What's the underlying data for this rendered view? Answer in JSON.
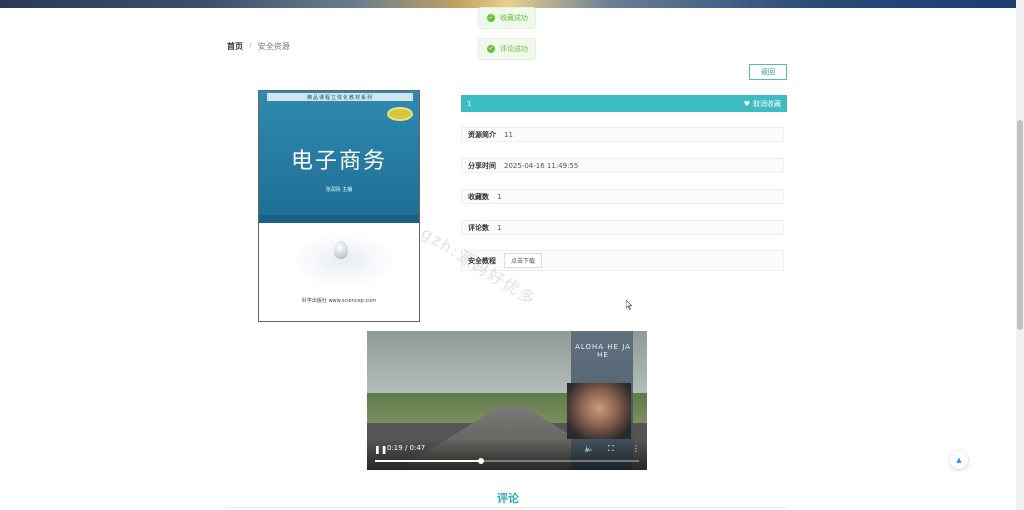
{
  "toasts": [
    {
      "text": "收藏成功"
    },
    {
      "text": "评论成功"
    }
  ],
  "breadcrumb": {
    "home": "首页",
    "separator": "/",
    "current": "安全资源"
  },
  "back_button": "返回",
  "book_cover": {
    "series": "精品课程立体化教材系列",
    "title": "电子商务",
    "author": "张润彤  主编",
    "publisher": "科学出版社 www.sciencep.com"
  },
  "detail": {
    "name": "1",
    "favorite_action": "取消收藏",
    "rows": [
      {
        "label": "资源简介",
        "value": "11"
      },
      {
        "label": "分享时间",
        "value": "2025-04-16 11:49:55"
      },
      {
        "label": "收藏数",
        "value": "1"
      },
      {
        "label": "评论数",
        "value": "1"
      }
    ],
    "tutorial": {
      "label": "安全教程",
      "button": "点击下载"
    }
  },
  "watermark": "gzh:源码好优多",
  "video": {
    "poster_title": "ALOHA HE JA HE",
    "current_time": "0:19",
    "duration": "0:47",
    "time_display": "0:19 / 0:47",
    "progress": 0.4
  },
  "comments": {
    "title": "评论"
  },
  "colors": {
    "accent": "#3cbcc3",
    "success": "#67c23a",
    "link": "#2c8c9a"
  },
  "icons": {
    "toast": "check-circle-icon",
    "favorite": "heart-icon",
    "back_to_top": "arrow-up-icon"
  }
}
